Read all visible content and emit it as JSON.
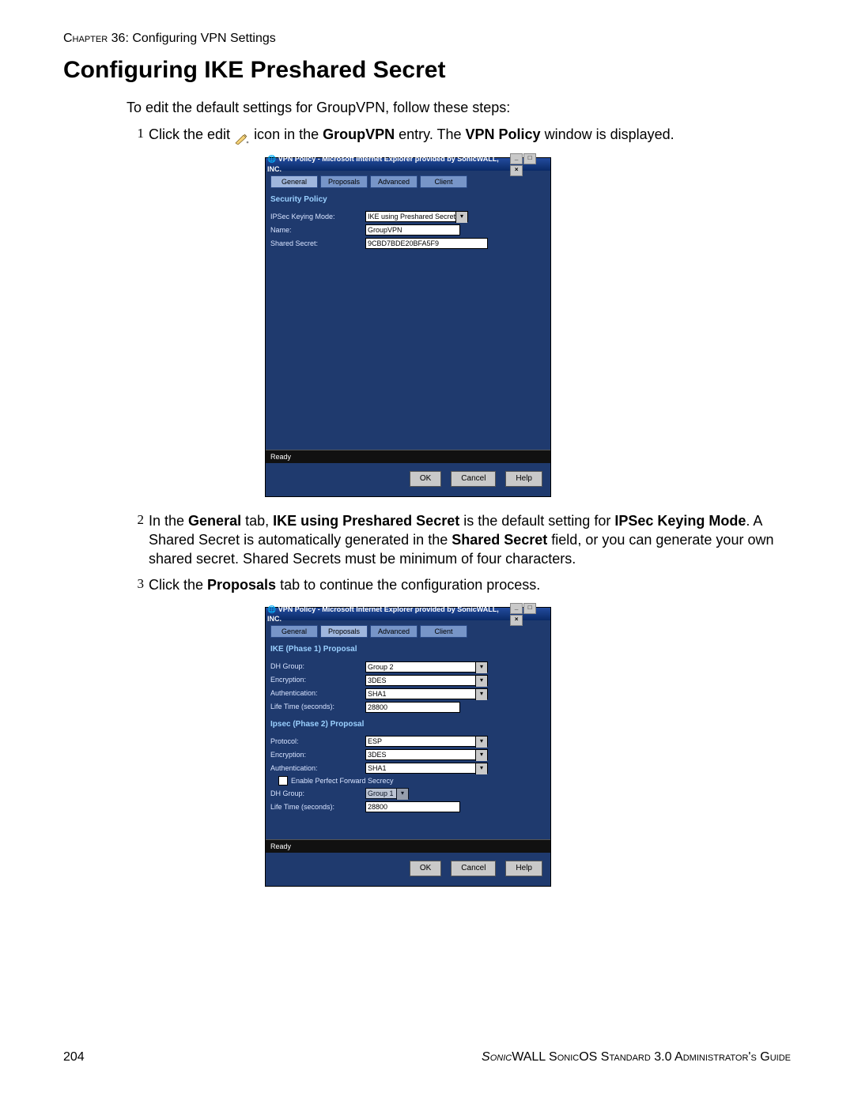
{
  "chapter_prefix": "Chapter",
  "chapter_no": "36",
  "chapter_title": "Configuring VPN Settings",
  "page_title": "Configuring IKE Preshared Secret",
  "intro": "To edit the default settings for GroupVPN, follow these steps:",
  "step1": {
    "num": "1",
    "a": "Click the edit ",
    "b": " icon in the ",
    "bold1": "GroupVPN",
    "c": " entry. The ",
    "bold2": "VPN Policy",
    "d": " window is displayed."
  },
  "step2": {
    "num": "2",
    "a": "In the ",
    "b1": "General",
    "b": " tab, ",
    "b2": "IKE using Preshared Secret",
    "c": " is the default setting for ",
    "b3": "IPSec Keying Mode",
    "d": ". A Shared Secret is automatically generated in the ",
    "b4": "Shared Secret",
    "e": " field, or you can generate your own shared secret. Shared Secrets must be minimum of four characters."
  },
  "step3": {
    "num": "3",
    "a": "Click the ",
    "b1": "Proposals",
    "b": " tab to continue the configuration process."
  },
  "dialog": {
    "title": "VPN Policy - Microsoft Internet Explorer provided by SonicWALL, INC.",
    "tabs": {
      "general": "General",
      "proposals": "Proposals",
      "advanced": "Advanced",
      "client": "Client"
    },
    "status": "Ready",
    "buttons": {
      "ok": "OK",
      "cancel": "Cancel",
      "help": "Help"
    }
  },
  "dlg1": {
    "section": "Security Policy",
    "row1": {
      "lbl": "IPSec Keying Mode:",
      "val": "IKE using Preshared Secret"
    },
    "row2": {
      "lbl": "Name:",
      "val": "GroupVPN"
    },
    "row3": {
      "lbl": "Shared Secret:",
      "val": "9CBD7BDE20BFA5F9"
    }
  },
  "dlg2": {
    "section1": "IKE (Phase 1) Proposal",
    "p1": {
      "dh": {
        "lbl": "DH Group:",
        "val": "Group 2"
      },
      "enc": {
        "lbl": "Encryption:",
        "val": "3DES"
      },
      "auth": {
        "lbl": "Authentication:",
        "val": "SHA1"
      },
      "life": {
        "lbl": "Life Time (seconds):",
        "val": "28800"
      }
    },
    "section2": "Ipsec (Phase 2) Proposal",
    "p2": {
      "proto": {
        "lbl": "Protocol:",
        "val": "ESP"
      },
      "enc": {
        "lbl": "Encryption:",
        "val": "3DES"
      },
      "auth": {
        "lbl": "Authentication:",
        "val": "SHA1"
      },
      "pfs": "Enable Perfect Forward Secrecy",
      "dh": {
        "lbl": "DH Group:",
        "val": "Group 1"
      },
      "life": {
        "lbl": "Life Time (seconds):",
        "val": "28800"
      }
    }
  },
  "footer": {
    "page_no": "204",
    "brand1": "Sonic",
    "brand2": "WALL SonicOS Standard 3.0 Administrator's Guide"
  }
}
